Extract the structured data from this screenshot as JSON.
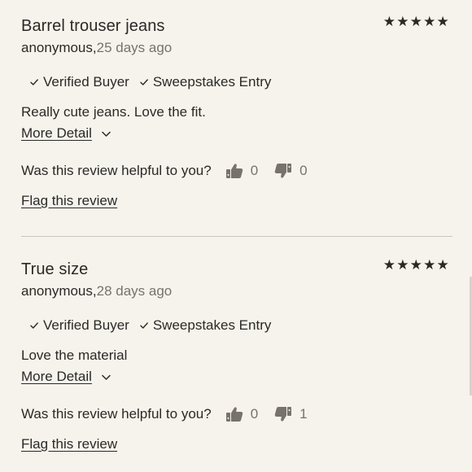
{
  "reviews": [
    {
      "title": "Barrel trouser jeans",
      "stars": "★★★★★",
      "rating": 5,
      "author": "anonymous,",
      "date": "25 days ago",
      "badges": [
        "Verified Buyer",
        "Sweepstakes Entry"
      ],
      "text": "Really cute jeans. Love the fit.",
      "more_label": "More Detail",
      "helpful_question": "Was this review helpful to you?",
      "helpful_yes": "0",
      "helpful_no": "0",
      "flag_label": "Flag this review"
    },
    {
      "title": "True size",
      "stars": "★★★★★",
      "rating": 5,
      "author": "anonymous,",
      "date": "28 days ago",
      "badges": [
        "Verified Buyer",
        "Sweepstakes Entry"
      ],
      "text": "Love the material",
      "more_label": "More Detail",
      "helpful_question": "Was this review helpful to you?",
      "helpful_yes": "0",
      "helpful_no": "1",
      "flag_label": "Flag this review"
    }
  ],
  "colors": {
    "background": "#f6f3ec",
    "text": "#2b2926",
    "muted": "#77736c",
    "divider": "#c9c5bd"
  },
  "icons": {
    "check": "check-icon",
    "chevron": "chevron-down-icon",
    "thumbs_up": "thumbs-up-icon",
    "thumbs_down": "thumbs-down-icon",
    "star": "star-icon"
  }
}
